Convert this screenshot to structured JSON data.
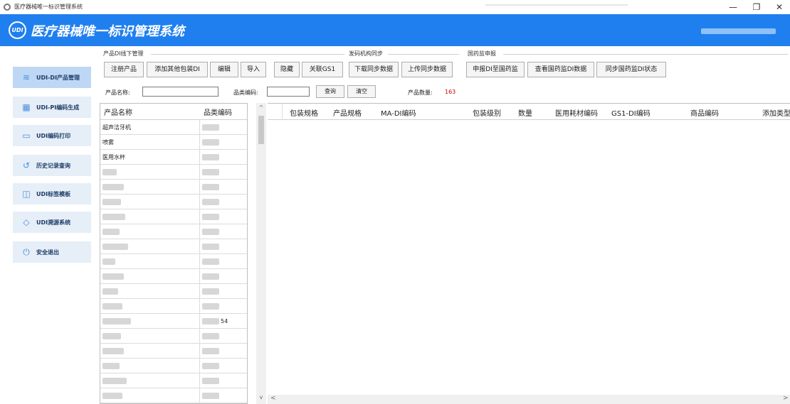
{
  "window": {
    "title": "医疗器械唯一标识管理系统",
    "minimize": "—",
    "maximize": "❐",
    "close": "✕"
  },
  "banner": {
    "logo_text": "UDI",
    "title": "医疗器械唯一标识管理系统"
  },
  "sidebar": {
    "items": [
      {
        "label": "UDI-DI产品管理",
        "icon": "layers-icon",
        "active": true
      },
      {
        "label": "UDI-PI编码生成",
        "icon": "qr-code-icon",
        "active": false
      },
      {
        "label": "UDI编码打印",
        "icon": "printer-icon",
        "active": false
      },
      {
        "label": "历史记录查询",
        "icon": "history-icon",
        "active": false
      },
      {
        "label": "UDI标签模板",
        "icon": "template-icon",
        "active": false
      },
      {
        "label": "UDI溯源系统",
        "icon": "trace-icon",
        "active": false
      },
      {
        "label": "安全退出",
        "icon": "power-icon",
        "active": false
      }
    ]
  },
  "toolbar": {
    "groups": [
      {
        "label": "产品DI线下管理"
      },
      {
        "label": "发码机构同步"
      },
      {
        "label": "国药监申报"
      }
    ],
    "buttons": {
      "register": "注册产品",
      "add_package": "添加其他包装DI",
      "edit": "编辑",
      "import": "导入",
      "hide": "隐藏",
      "link_gs1": "关联GS1",
      "download_sync": "下载同步数据",
      "upload_sync": "上传同步数据",
      "report_di": "申报DI至国药监",
      "view_di": "查看国药监DI数据",
      "sync_status": "同步国药监DI状态"
    }
  },
  "filter": {
    "name_label": "产品名称:",
    "name_value": "",
    "code_label": "品类编码:",
    "code_value": "",
    "query": "查询",
    "clear": "清空",
    "count_label": "产品数量:",
    "count_value": "163"
  },
  "left_table": {
    "headers": [
      "产品名称",
      "品类编码"
    ],
    "rows": [
      {
        "name": "超声洁牙机",
        "code": ""
      },
      {
        "name": "喷雾",
        "code": ""
      },
      {
        "name": "医用水杯",
        "code": ""
      },
      {
        "name": "",
        "code": ""
      },
      {
        "name": "",
        "code": ""
      },
      {
        "name": "",
        "code": ""
      },
      {
        "name": "",
        "code": ""
      },
      {
        "name": "",
        "code": ""
      },
      {
        "name": "",
        "code": ""
      },
      {
        "name": "",
        "code": ""
      },
      {
        "name": "",
        "code": ""
      },
      {
        "name": "",
        "code": ""
      },
      {
        "name": "",
        "code": ""
      },
      {
        "name": "",
        "code": "54"
      },
      {
        "name": "",
        "code": ""
      },
      {
        "name": "",
        "code": ""
      },
      {
        "name": "",
        "code": ""
      },
      {
        "name": "",
        "code": ""
      },
      {
        "name": "",
        "code": ""
      }
    ]
  },
  "right_table": {
    "headers": [
      "包装规格",
      "产品规格",
      "MA-DI编码",
      "包装级别",
      "数量",
      "医用耗材编码",
      "GS1-DI编码",
      "商品编码",
      "添加类型"
    ]
  },
  "scroll": {
    "up": "^",
    "down": "v",
    "left": "<",
    "right": ">"
  }
}
